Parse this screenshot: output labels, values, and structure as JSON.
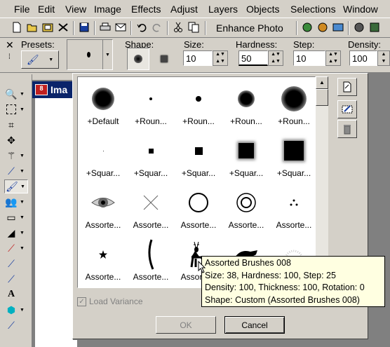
{
  "menu": [
    "File",
    "Edit",
    "View",
    "Image",
    "Effects",
    "Adjust",
    "Layers",
    "Objects",
    "Selections",
    "Window"
  ],
  "toolbar": {
    "enhance_label": "Enhance Photo",
    "icons": [
      "new-icon",
      "open-icon",
      "browse-icon",
      "scan-icon",
      "save-icon",
      "print-icon",
      "email-icon",
      "undo-icon",
      "redo-icon",
      "cut-icon",
      "copy-icon",
      "paste-icon"
    ]
  },
  "options": {
    "presets_label": "Presets:",
    "shape_label": "Shape:",
    "size_label": "Size:",
    "size_value": "10",
    "hardness_label": "Hardness:",
    "hardness_value": "50",
    "step_label": "Step:",
    "step_value": "10",
    "density_label": "Density:",
    "density_value": "100"
  },
  "image_window": {
    "title": "Ima"
  },
  "brushes": [
    {
      "label": "+Default",
      "kind": "soft-circle",
      "size": 32
    },
    {
      "label": "+Roun...",
      "kind": "dot",
      "size": 4
    },
    {
      "label": "+Roun...",
      "kind": "dot",
      "size": 8
    },
    {
      "label": "+Roun...",
      "kind": "soft-circle",
      "size": 24
    },
    {
      "label": "+Roun...",
      "kind": "soft-circle",
      "size": 36
    },
    {
      "label": "+Squar...",
      "kind": "dot",
      "size": 1
    },
    {
      "label": "+Squar...",
      "kind": "square",
      "size": 7
    },
    {
      "label": "+Squar...",
      "kind": "square",
      "size": 11
    },
    {
      "label": "+Squar...",
      "kind": "soft-square",
      "size": 22
    },
    {
      "label": "+Squar...",
      "kind": "soft-square",
      "size": 28
    },
    {
      "label": "Assorte...",
      "kind": "eye",
      "size": 32
    },
    {
      "label": "Assorte...",
      "kind": "x",
      "size": 22
    },
    {
      "label": "Assorte...",
      "kind": "ring",
      "size": 28
    },
    {
      "label": "Assorte...",
      "kind": "double-ring",
      "size": 28
    },
    {
      "label": "Assorte...",
      "kind": "dots3",
      "size": 10
    },
    {
      "label": "Assorte...",
      "kind": "star",
      "size": 10
    },
    {
      "label": "Assorte...",
      "kind": "stroke",
      "size": 40
    },
    {
      "label": "Assorte...",
      "kind": "deer",
      "size": 38
    },
    {
      "label": "Assorte...",
      "kind": "animal",
      "size": 32
    },
    {
      "label": "Assorte...",
      "kind": "spiky",
      "size": 26
    }
  ],
  "dialog": {
    "load_variance_label": "Load Variance",
    "ok_label": "OK",
    "cancel_label": "Cancel"
  },
  "tooltip": {
    "line1": "Assorted Brushes 008",
    "line2": "Size: 38, Hardness: 100, Step: 25",
    "line3": "Density: 100, Thickness: 100, Rotation: 0",
    "line4": "Shape: Custom (Assorted Brushes 008)"
  },
  "tools": [
    "zoom-icon",
    "selection-icon",
    "crop-icon",
    "move-icon",
    "magic-wand-icon",
    "dropper-icon",
    "paint-brush-icon",
    "clone-icon",
    "scratch-remover-icon",
    "dodge-icon",
    "red-eye-icon",
    "color-replacer-icon",
    "smudge-icon",
    "text-icon",
    "preset-shape-icon",
    "pen-icon"
  ]
}
